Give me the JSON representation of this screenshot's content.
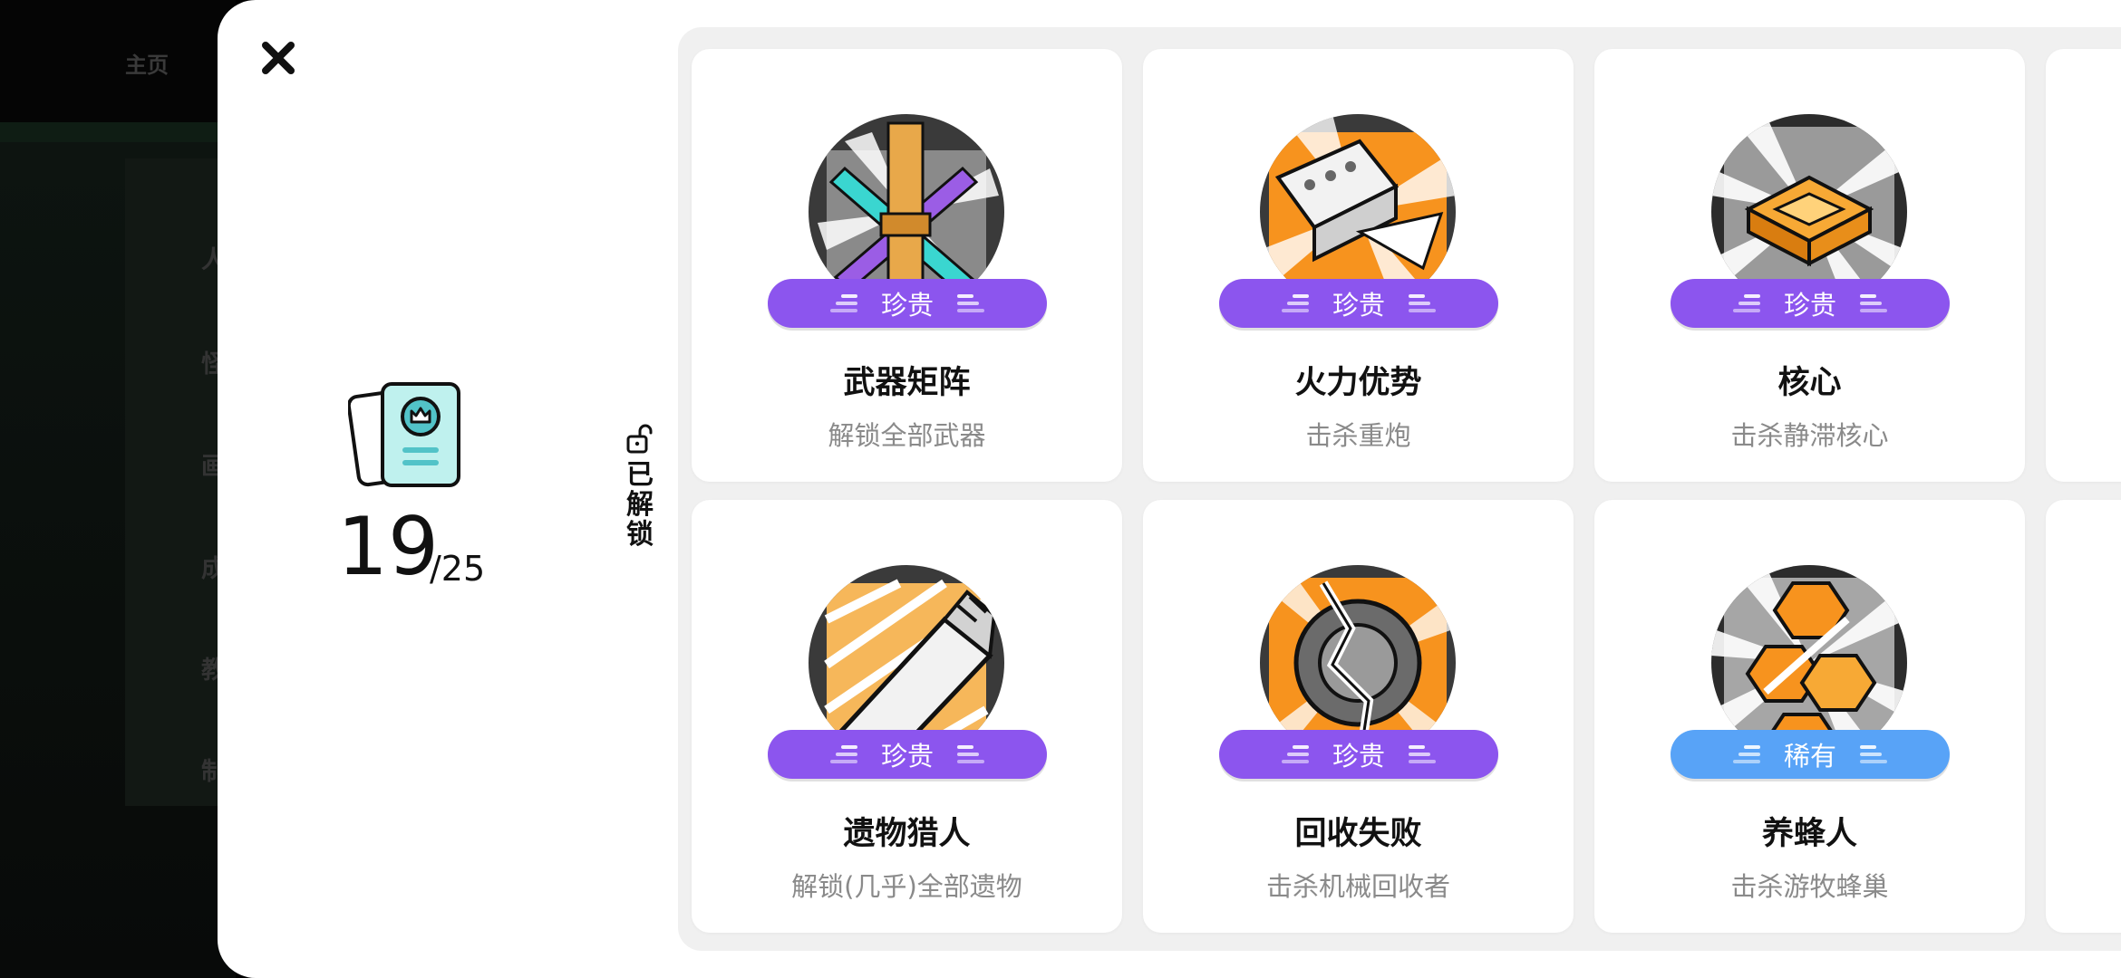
{
  "background": {
    "home_label": "主页",
    "menu_items": [
      "人",
      "怪",
      "画",
      "成",
      "教",
      "制"
    ]
  },
  "modal": {
    "stats": {
      "unlocked": "19",
      "total": "/25"
    },
    "tab_label": "已解锁",
    "cards": [
      {
        "title": "武器矩阵",
        "desc": "解锁全部武器",
        "rarity": "珍贵",
        "rarity_type": "epic",
        "icon": "weapon-matrix-icon"
      },
      {
        "title": "火力优势",
        "desc": "击杀重炮",
        "rarity": "珍贵",
        "rarity_type": "epic",
        "icon": "firepower-icon"
      },
      {
        "title": "核心",
        "desc": "击杀静滞核心",
        "rarity": "珍贵",
        "rarity_type": "epic",
        "icon": "core-icon"
      },
      {
        "title": "遗物猎人",
        "desc": "解锁(几乎)全部遗物",
        "rarity": "珍贵",
        "rarity_type": "epic",
        "icon": "relic-hunter-icon"
      },
      {
        "title": "回收失败",
        "desc": "击杀机械回收者",
        "rarity": "珍贵",
        "rarity_type": "epic",
        "icon": "recycle-fail-icon"
      },
      {
        "title": "养蜂人",
        "desc": "击杀游牧蜂巢",
        "rarity": "稀有",
        "rarity_type": "rare",
        "icon": "beekeeper-icon"
      }
    ]
  },
  "colors": {
    "epic": "#8c55ee",
    "rare": "#58a3f7",
    "accent_orange": "#f7931e"
  }
}
